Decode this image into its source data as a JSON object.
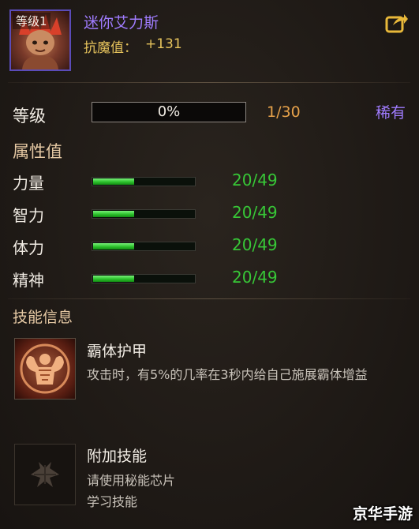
{
  "header": {
    "level_badge": "等级1",
    "name": "迷你艾力斯",
    "resist_label": "抗魔值：",
    "resist_value": "+131",
    "share_icon": "share-icon"
  },
  "level": {
    "label": "等级",
    "progress_text": "0%",
    "progress_fraction": 0,
    "count": "1/30",
    "rarity": "稀有"
  },
  "attributes": {
    "title": "属性值",
    "stats": [
      {
        "label": "力量",
        "value": "20/49",
        "fraction": 0.41
      },
      {
        "label": "智力",
        "value": "20/49",
        "fraction": 0.41
      },
      {
        "label": "体力",
        "value": "20/49",
        "fraction": 0.41
      },
      {
        "label": "精神",
        "value": "20/49",
        "fraction": 0.41
      }
    ]
  },
  "skills": {
    "title": "技能信息",
    "items": [
      {
        "name": "霸体护甲",
        "desc_lines": [
          "攻击时，有5%的几率在3秒内给自己施展霸体增益"
        ],
        "icon": "muscle-icon"
      },
      {
        "name": "附加技能",
        "desc_lines": [
          "请使用秘能芯片",
          "学习技能"
        ],
        "icon": "rune-icon"
      }
    ]
  },
  "watermark": "京华手游",
  "colors": {
    "name": "#a07cff",
    "resist": "#e6c35c",
    "level_count": "#e6a14a",
    "stat_value": "#37c737",
    "stat_fill": "#2cc12c"
  }
}
